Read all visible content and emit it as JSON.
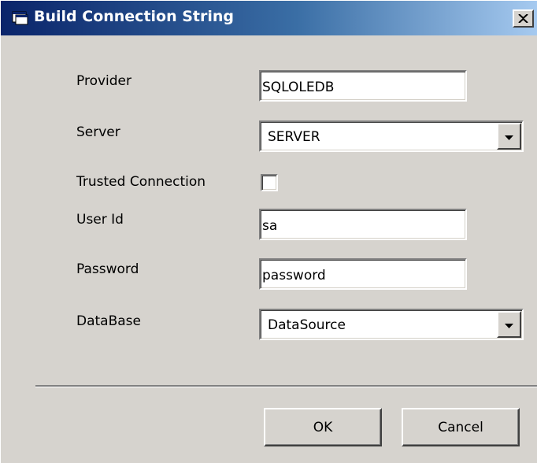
{
  "window": {
    "title": "Build Connection String",
    "title_icon": "dialog-app-icon",
    "close_icon": "close-x-icon"
  },
  "form": {
    "provider": {
      "label": "Provider",
      "value": "SQLOLEDB"
    },
    "server": {
      "label": "Server",
      "value": "SERVER",
      "icon": "chevron-down-icon"
    },
    "trusted_connection": {
      "label": "Trusted Connection",
      "checked": false
    },
    "user_id": {
      "label": "User Id",
      "value": "sa"
    },
    "password": {
      "label": "Password",
      "value": "password"
    },
    "database": {
      "label": "DataBase",
      "value": "DataSource",
      "icon": "chevron-down-icon"
    }
  },
  "buttons": {
    "ok_label": "OK",
    "cancel_label": "Cancel"
  },
  "colors": {
    "dialog_face": "#d6d3ce",
    "title_start": "#0a246a",
    "title_end": "#a6caf0"
  }
}
